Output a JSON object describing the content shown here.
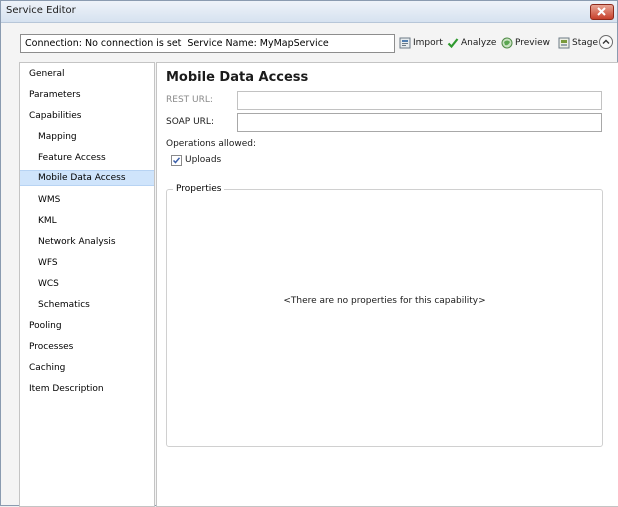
{
  "window": {
    "title": "Service Editor",
    "close_icon": "close-icon"
  },
  "toolbar": {
    "connection_text": "Connection: No connection is set",
    "service_name_text": "Service Name: MyMapService",
    "buttons": [
      {
        "label": "Import",
        "icon": "import-icon"
      },
      {
        "label": "Analyze",
        "icon": "checkmark-icon"
      },
      {
        "label": "Preview",
        "icon": "preview-icon"
      },
      {
        "label": "Stage",
        "icon": "stage-icon"
      }
    ]
  },
  "sidebar": {
    "selected": "Mobile Data Access",
    "items": [
      {
        "label": "General",
        "indent": 0
      },
      {
        "label": "Parameters",
        "indent": 0
      },
      {
        "label": "Capabilities",
        "indent": 0
      },
      {
        "label": "Mapping",
        "indent": 1
      },
      {
        "label": "Feature Access",
        "indent": 1
      },
      {
        "label": "Mobile Data Access",
        "indent": 1
      },
      {
        "label": "WMS",
        "indent": 1
      },
      {
        "label": "KML",
        "indent": 1
      },
      {
        "label": "Network Analysis",
        "indent": 1
      },
      {
        "label": "WFS",
        "indent": 1
      },
      {
        "label": "WCS",
        "indent": 1
      },
      {
        "label": "Schematics",
        "indent": 1
      },
      {
        "label": "Pooling",
        "indent": 0
      },
      {
        "label": "Processes",
        "indent": 0
      },
      {
        "label": "Caching",
        "indent": 0
      },
      {
        "label": "Item Description",
        "indent": 0
      }
    ]
  },
  "main": {
    "heading": "Mobile Data Access",
    "rest_url_label": "REST URL:",
    "rest_url_value": "",
    "soap_url_label": "SOAP URL:",
    "soap_url_value": "",
    "operations_label": "Operations allowed:",
    "uploads_label": "Uploads",
    "uploads_checked": true,
    "properties_title": "Properties",
    "properties_empty": "<There are no properties for this capability>"
  }
}
